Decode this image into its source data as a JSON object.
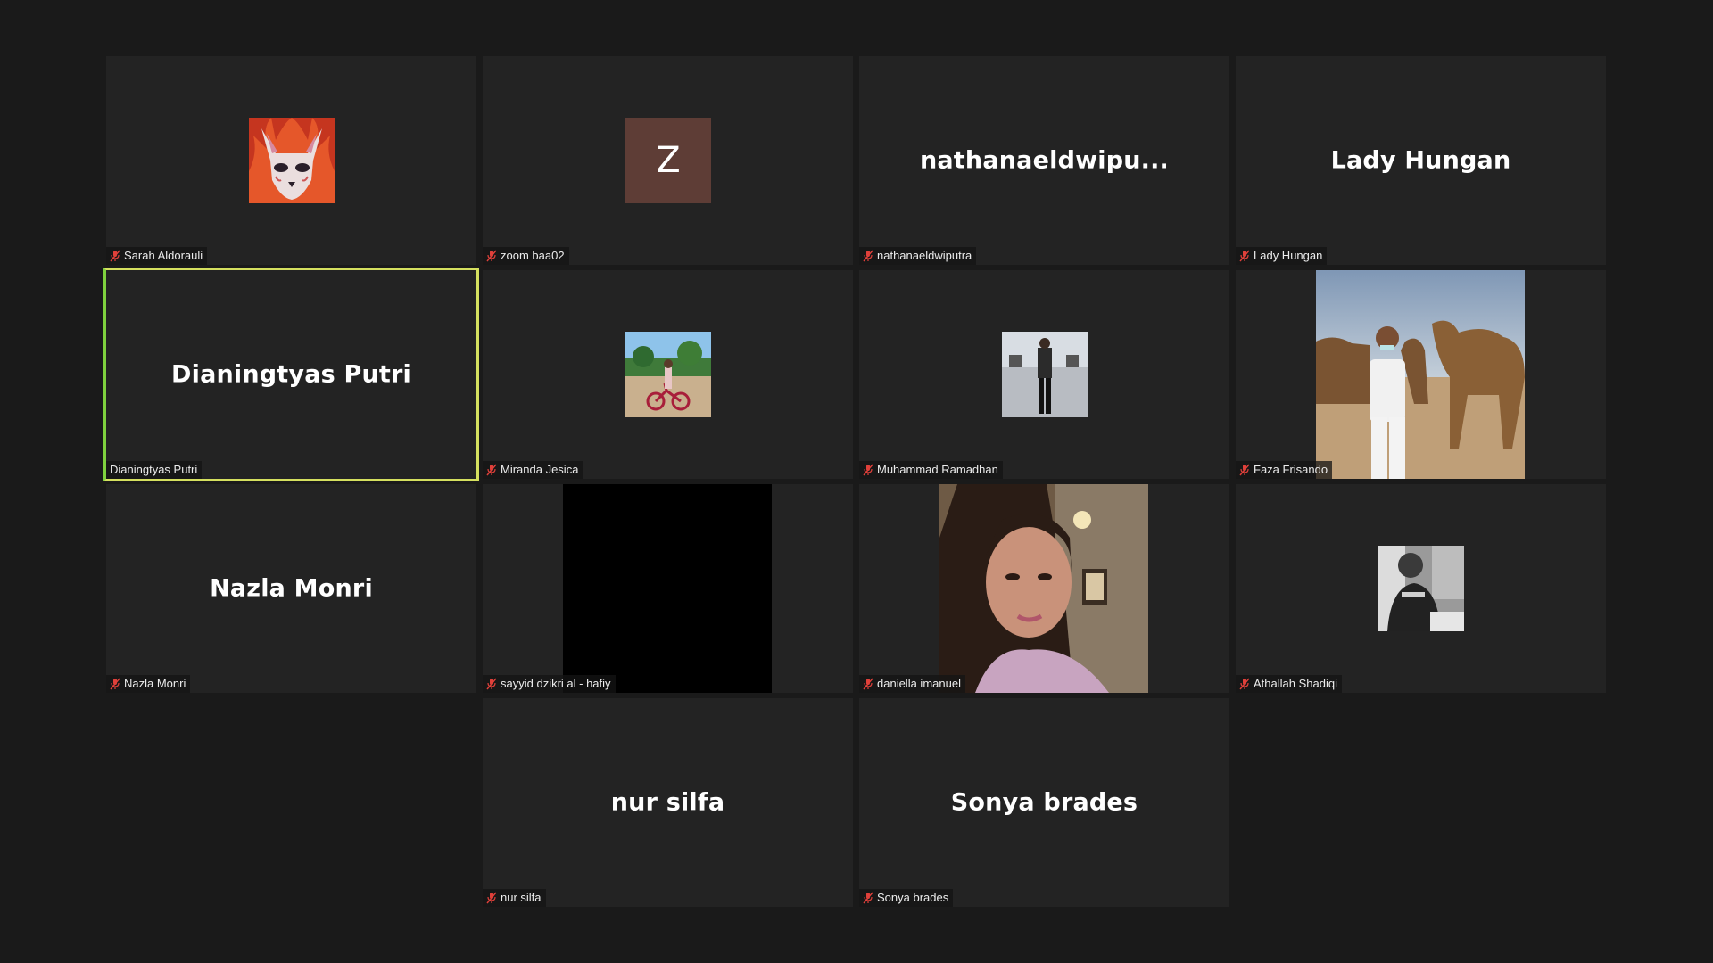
{
  "participants": [
    {
      "display": "",
      "label": "Sarah Aldorauli"
    },
    {
      "display": "Z",
      "label": "zoom baa02"
    },
    {
      "display": "nathanaeldwipu...",
      "label": "nathanaeldwiputra"
    },
    {
      "display": "Lady Hungan",
      "label": "Lady Hungan"
    },
    {
      "display": "Dianingtyas Putri",
      "label": "Dianingtyas Putri"
    },
    {
      "display": "",
      "label": "Miranda Jesica"
    },
    {
      "display": "",
      "label": "Muhammad Ramadhan"
    },
    {
      "display": "",
      "label": "Faza Frisando"
    },
    {
      "display": "Nazla Monri",
      "label": "Nazla Monri"
    },
    {
      "display": "",
      "label": "sayyid dzikri al - hafiy"
    },
    {
      "display": "",
      "label": "daniella imanuel"
    },
    {
      "display": "",
      "label": "Athallah Shadiqi"
    },
    {
      "display": "nur silfa",
      "label": "nur silfa"
    },
    {
      "display": "Sonya brades",
      "label": "Sonya brades"
    }
  ],
  "colors": {
    "background": "#1a1a1a",
    "tile": "#232323",
    "active_speaker_border": "#d5e05f",
    "muted_mic": "#e0403a",
    "avatar_letter_bg": "#5e3d36"
  },
  "icons": {
    "muted": "muted-microphone-icon"
  }
}
